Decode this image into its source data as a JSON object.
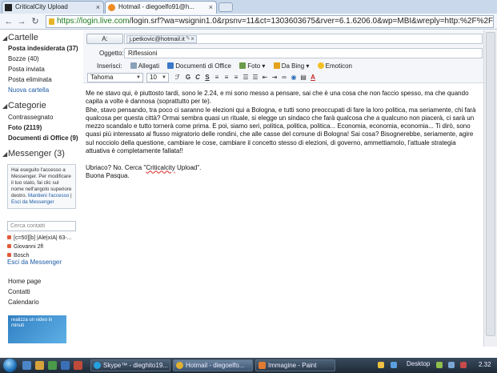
{
  "browser": {
    "tabs": [
      {
        "title": "CriticalCity Upload"
      },
      {
        "title": "Hotmail - diegoelfo91@h..."
      }
    ],
    "url_secure": "https://login.live.com",
    "url_rest": "/login.srf?wa=wsignin1.0&rpsnv=11&ct=1303603675&rver=6.1.6206.0&wp=MBI&wreply=http:%2F%2F"
  },
  "sidebar": {
    "folders_title": "Cartelle",
    "folders": [
      {
        "label": "Posta indesiderata (37)",
        "bold": true
      },
      {
        "label": "Bozze (40)"
      },
      {
        "label": "Posta inviata"
      },
      {
        "label": "Posta eliminata"
      },
      {
        "label": "Nuova cartella",
        "link": true
      }
    ],
    "categories_title": "Categorie",
    "categories": [
      {
        "label": "Contrassegnato"
      },
      {
        "label": "Foto (2119)",
        "bold": true
      },
      {
        "label": "Documenti di Office (9)",
        "bold": true
      }
    ],
    "messenger_title": "Messenger (3)",
    "messenger_note": "Hai eseguito l'accesso a Messenger. Per modificare il tuo stato, fai clic sul nome nell'angolo superiore destro.",
    "messenger_keep": "Mantieni l'accesso",
    "messenger_exit": "Esci da Messenger",
    "search_placeholder": "Cerca contatti",
    "contacts": [
      "[c=50][b] |Ale|xIA| 63-...",
      "Giovanni 2fl",
      "Bosch"
    ],
    "exit_messenger": "Esci da Messenger",
    "links": [
      "Home page",
      "Contatti",
      "Calendario"
    ],
    "ad_text": "realizza un video in minuti"
  },
  "compose": {
    "to_button": "A:",
    "to_recipient": "j.petkovic@hotmail.it",
    "subject_label": "Oggetto:",
    "subject_value": "Riflessioni",
    "insert_label": "Inserisci:",
    "insert_items": [
      "Allegati",
      "Documenti di Office",
      "Foto",
      "Da Bing",
      "Emoticon"
    ],
    "font_name": "Tahoma",
    "font_size": "10",
    "body_p1": "Me ne stavo qui, è piuttosto tardi, sono le 2.24, e mi sono messo a pensare, sai che è una cosa che non faccio spesso, ma che quando capita a volte è dannosa (soprattutto per te).",
    "body_p2": "Bhe, stavo pensando, tra poco ci saranno le elezioni qui a Bologna, e tutti sono preoccupati di fare la loro politica, ma seriamente, chi farà qualcosa per questa città? Ormai sembra quasi un rituale, si elegge un sindaco che farà qualcosa che a qualcuno non piacerà, ci sarà un mezzo scandalo e tutto tornerà come prima. E poi, siamo seri, politica, politica, politica... Economia, economia, economia... Ti dirò, sono quasi più interessato al flusso migratorio delle rondini, che alle casse del comune di Bologna! Sai cosa? Bisognerebbe, seriamente, agire sul nocciolo della questione, cambiare le cose, cambiare il concetto stesso di elezioni, di governo, ammettiamolo, l'attuale strategia attuativa è completamente fallata!!",
    "body_p3a": "Ubriaco? No. Cerca \"",
    "body_p3b": "Criticalcity",
    "body_p3c": " Upload\".",
    "body_p4": "Buona Pasqua."
  },
  "taskbar": {
    "tasks": [
      "Skype™ - dieghito19...",
      "Hotmail - diegoelfo...",
      "Immagine - Paint"
    ],
    "desktop": "Desktop",
    "clock": "2.32"
  },
  "colors": {
    "accent": "#1d5aa6",
    "taskbar": "#2a3a4c"
  }
}
